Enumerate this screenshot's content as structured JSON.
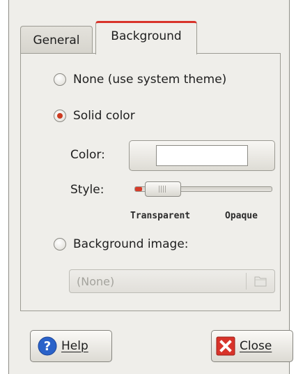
{
  "tabs": {
    "general": "General",
    "background": "Background"
  },
  "background": {
    "none_option": "None (use system theme)",
    "solid_option": "Solid color",
    "color_label": "Color:",
    "color_value": "#ffffff",
    "style_label": "Style:",
    "style_level": 0.05,
    "style_min_label": "Transparent",
    "style_max_label": "Opaque",
    "image_option": "Background image:",
    "image_value": "(None)",
    "selected": "solid"
  },
  "buttons": {
    "help": "Help",
    "close": "Close"
  },
  "colors": {
    "accent": "#d63c2a",
    "help_icon": "#2a62c9"
  },
  "icons": {
    "help": "help-icon",
    "close": "close-icon",
    "folder": "folder-icon"
  }
}
